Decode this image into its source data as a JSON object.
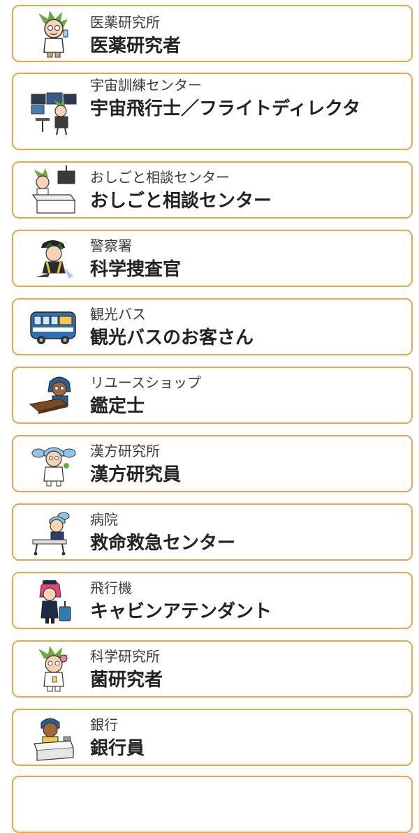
{
  "accent_color": "#f0a54b",
  "items": [
    {
      "place": "医薬研究所",
      "job": "医薬研究者",
      "icon": "green-hair-researcher-avatar-icon",
      "hair": "#6fa843"
    },
    {
      "place": "宇宙訓練センター",
      "job": "宇宙飛行士／フライトディレクタ",
      "icon": "flight-director-monitors-avatar-icon",
      "hair": "#6fa843"
    },
    {
      "place": "おしごと相談センター",
      "job": "おしごと相談センター",
      "icon": "consultation-desk-avatar-icon",
      "hair": "#6fa843"
    },
    {
      "place": "警察署",
      "job": "科学捜査官",
      "icon": "forensic-investigator-avatar-icon",
      "hair": "#2d5a2d"
    },
    {
      "place": "観光バス",
      "job": "観光バスのお客さん",
      "icon": "tour-bus-icon",
      "hair": "#2f6fb3"
    },
    {
      "place": "リユースショップ",
      "job": "鑑定士",
      "icon": "appraiser-at-desk-avatar-icon",
      "hair": "#2f5d8a"
    },
    {
      "place": "漢方研究所",
      "job": "漢方研究員",
      "icon": "blue-twin-tail-researcher-avatar-icon",
      "hair": "#8ec5e6"
    },
    {
      "place": "病院",
      "job": "救命救急センター",
      "icon": "emergency-staff-stretcher-avatar-icon",
      "hair": "#8ec5e6"
    },
    {
      "place": "飛行機",
      "job": "キャビンアテンダント",
      "icon": "cabin-attendant-suitcase-avatar-icon",
      "hair": "#e0457b"
    },
    {
      "place": "科学研究所",
      "job": "菌研究者",
      "icon": "green-hair-scientist-avatar-icon",
      "hair": "#6fa843"
    },
    {
      "place": "銀行",
      "job": "銀行員",
      "icon": "bank-teller-counter-avatar-icon",
      "hair": "#2f5d8a"
    }
  ]
}
